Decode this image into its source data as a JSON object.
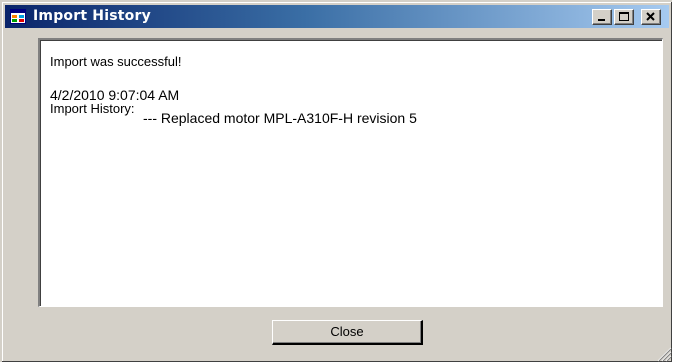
{
  "window": {
    "title": "Import History",
    "titlebar_color_left": "#0a246a",
    "titlebar_color_right": "#a6caf0",
    "face_color": "#d4d0c8",
    "icon": "app-window-icon"
  },
  "caption_buttons": {
    "minimize_icon": "minimize-icon",
    "maximize_icon": "maximize-icon",
    "close_icon": "close-icon"
  },
  "message": {
    "line1": "Import was successful!",
    "line2": "4/2/2010 9:07:04 AM",
    "line3": "Import History:",
    "line4": "--- Replaced motor MPL-A310F-H revision 5"
  },
  "buttons": {
    "close_label": "Close"
  }
}
